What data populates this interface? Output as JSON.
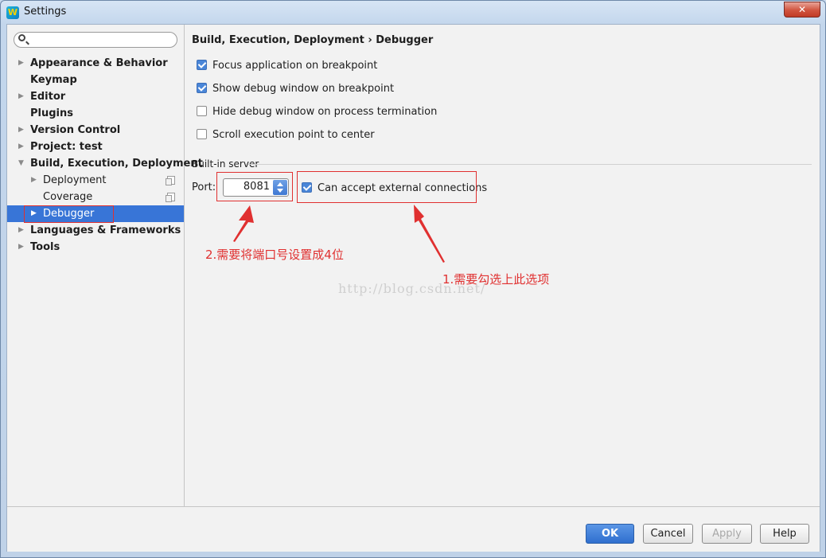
{
  "window": {
    "title": "Settings",
    "app_icon": "webstorm-icon",
    "close_label": "✕"
  },
  "search": {
    "placeholder": ""
  },
  "sidebar": {
    "items": [
      {
        "label": "Appearance & Behavior",
        "expandable": true
      },
      {
        "label": "Keymap",
        "expandable": false
      },
      {
        "label": "Editor",
        "expandable": true
      },
      {
        "label": "Plugins",
        "expandable": false
      },
      {
        "label": "Version Control",
        "expandable": true
      },
      {
        "label": "Project: test",
        "expandable": true
      },
      {
        "label": "Build, Execution, Deployment",
        "expandable": true,
        "expanded": true
      },
      {
        "label": "Deployment",
        "expandable": true,
        "child": true
      },
      {
        "label": "Coverage",
        "expandable": false,
        "child": true
      },
      {
        "label": "Debugger",
        "expandable": true,
        "child": true,
        "selected": true
      },
      {
        "label": "Languages & Frameworks",
        "expandable": true
      },
      {
        "label": "Tools",
        "expandable": true
      }
    ]
  },
  "content": {
    "breadcrumb": {
      "parent": "Build, Execution, Deployment",
      "sep": "›",
      "current": "Debugger"
    },
    "checkboxes": [
      {
        "label": "Focus application on breakpoint",
        "checked": true
      },
      {
        "label": "Show debug window on breakpoint",
        "checked": true
      },
      {
        "label": "Hide debug window on process termination",
        "checked": false
      },
      {
        "label": "Scroll execution point to center",
        "checked": false
      }
    ],
    "builtin_server": {
      "section_title": "Built-in server",
      "port_label": "Port:",
      "port_value": "8081",
      "external_label": "Can accept external connections",
      "external_checked": true
    }
  },
  "annotations": {
    "port_note": "2.需要将端口号设置成4位",
    "external_note": "1.需要勾选上此选项",
    "watermark": "http://blog.csdn.net/"
  },
  "footer": {
    "ok": "OK",
    "cancel": "Cancel",
    "apply": "Apply",
    "help": "Help"
  },
  "colors": {
    "selection": "#3875d7",
    "annotation_red": "#e03030",
    "primary_button": "#2f6fcf"
  }
}
